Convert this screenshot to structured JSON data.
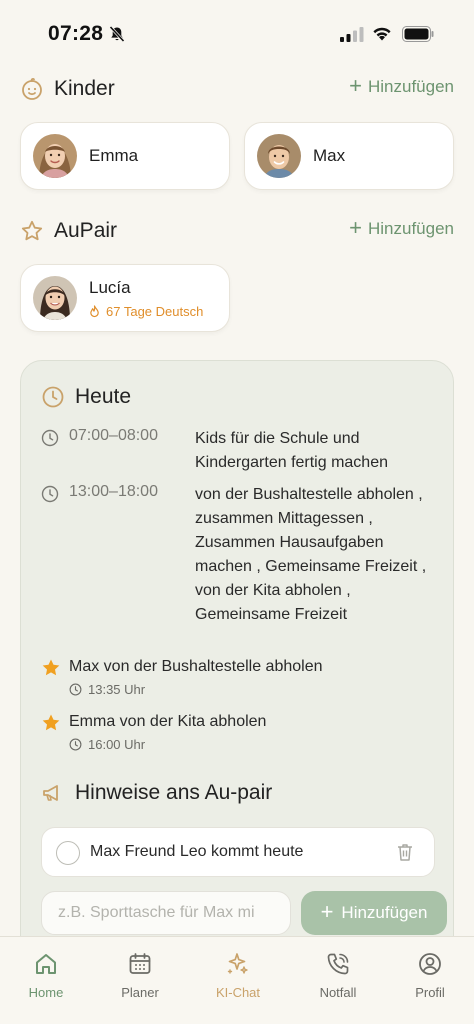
{
  "status": {
    "time": "07:28"
  },
  "kinder": {
    "title": "Kinder",
    "add_label": "Hinzufügen",
    "children": [
      {
        "name": "Emma"
      },
      {
        "name": "Max"
      }
    ]
  },
  "aupair": {
    "title": "AuPair",
    "add_label": "Hinzufügen",
    "person": {
      "name": "Lucía",
      "streak": "67 Tage Deutsch"
    }
  },
  "today": {
    "title": "Heute",
    "schedule": [
      {
        "time": "07:00–08:00",
        "text": "Kids für die Schule und Kindergarten fertig machen"
      },
      {
        "time": "13:00–18:00",
        "text": "von der Bushaltestelle abholen , zusammen Mittagessen , Zusammen Hausaufgaben machen , Gemeinsame Freizeit , von der Kita abholen , Gemeinsame Freizeit"
      }
    ],
    "tasks": [
      {
        "title": "Max von der Bushaltestelle abholen",
        "time": "13:35 Uhr"
      },
      {
        "title": "Emma von der Kita abholen",
        "time": "16:00 Uhr"
      }
    ]
  },
  "notes": {
    "title": "Hinweise ans Au-pair",
    "items": [
      {
        "text": "Max Freund Leo kommt heute"
      }
    ],
    "input_placeholder": "z.B. Sporttasche für Max mi",
    "add_label": "Hinzufügen"
  },
  "nav": {
    "items": [
      {
        "label": "Home",
        "icon": "home-icon",
        "active": true
      },
      {
        "label": "Planer",
        "icon": "calendar-icon"
      },
      {
        "label": "KI-Chat",
        "icon": "sparkle-icon"
      },
      {
        "label": "Notfall",
        "icon": "phone-icon"
      },
      {
        "label": "Profil",
        "icon": "user-circle-icon"
      }
    ]
  },
  "colors": {
    "accent_green": "#6d9470",
    "accent_gold": "#c9a26a",
    "streak_orange": "#e08e2b",
    "star_orange": "#f0a020",
    "nav_inactive": "#6b6b66"
  }
}
